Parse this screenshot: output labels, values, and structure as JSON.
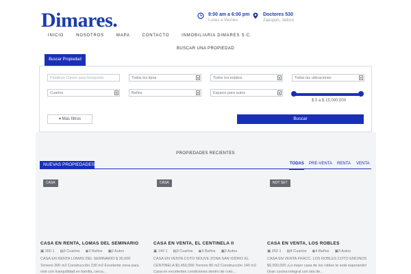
{
  "header": {
    "logo_text": "Dimares.",
    "hours": {
      "icon": "clock-icon",
      "line1": "9:00 am a 6:00 pm",
      "line2": "Lunes a Viernes"
    },
    "address": {
      "icon": "map-pin-icon",
      "line1": "Doctores 530",
      "line2": "Zapopan, Jalisco"
    }
  },
  "nav": {
    "items": [
      "INICIO",
      "NOSOTROS",
      "MAPA",
      "CONTACTO",
      "INMOBILIARIA DIMARES S.C."
    ]
  },
  "search": {
    "title": "BUSCAR UNA PROPIEDAD",
    "tab_label": "Buscar Propiedad",
    "keywords_placeholder": "Palabras Claves para búsqueda",
    "types": "Todos los tipos",
    "statuses": "Todos los estatus",
    "locations": "Todas las ubicaciones",
    "rooms": "Cuartos",
    "baths": "Baños",
    "parking": "Espacio para autos",
    "price_range": "$ 0 a $ 15,000,000",
    "price_min_fraction": 0,
    "price_max_fraction": 1,
    "more_filters": "Más filtros",
    "search_button": "Buscar"
  },
  "recent": {
    "title": "PROPIEDADES RECIENTES",
    "tab_label": "NUEVAS PROPIEDADES",
    "filters": [
      "TODAS",
      "PRE-VENTA",
      "RENTA",
      "VENTA"
    ],
    "active_filter": "TODAS",
    "properties": [
      {
        "badge": "CASA",
        "title": "CASA EN RENTA, LOMAS DEL SEMINARIO",
        "area": "300 1",
        "rooms": "3 Cuartos",
        "baths": "3 Baños",
        "cars": "2 Autos",
        "desc": "CASA EN RENTA LOMAS DEL SEMINARIO $ 30,000 Terreno 300 m2 Construcción 230 m2   Excelente zona para vivir con tranquilidad en familia, cerca..."
      },
      {
        "badge": "CASA",
        "title": "CASA EN VENTA, EL CENTINELA II",
        "area": "140 1",
        "rooms": "3 Cuartos",
        "baths": "3 Baños",
        "cars": "2 Autos",
        "desc": "CASA EN VENTA COTO NOUVE ZONA SAN ISIDRO EL CENTINELA $3,450,000   Terreno 80 m2 Construcción 140 m2 Casa en excelentes condiciones dentro de coto..."
      },
      {
        "badge": "NOT SET",
        "title": "CASA EN VENTA, LOS ROBLES",
        "area": "250 1",
        "rooms": "4 Cuartos",
        "baths": "4 Baños",
        "cars": "3 Autos",
        "desc": "CASA EN VENTA FRACC. LOS ROBLES COTO ENCINOS $6,900,000   ¡La mejor casa de los robles te está esperando! Gran cocina integral con isla de..."
      }
    ]
  },
  "colors": {
    "brand": "#1a2fb8",
    "logo": "#1a3caa",
    "panel_bg": "#f3f4f6",
    "badge": "#666a70"
  }
}
